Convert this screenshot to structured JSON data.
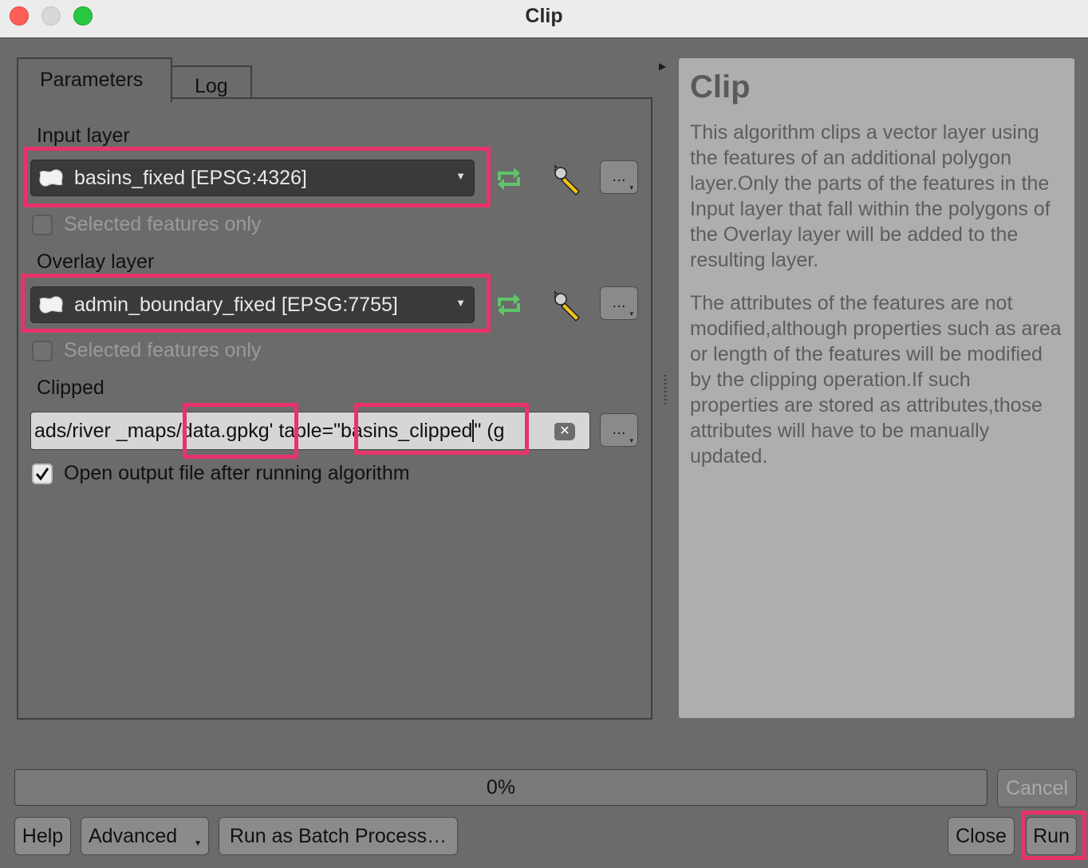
{
  "window": {
    "title": "Clip"
  },
  "tabs": {
    "parameters": "Parameters",
    "log": "Log"
  },
  "input_layer": {
    "label": "Input layer",
    "value": "basins_fixed [EPSG:4326]",
    "selected_only_label": "Selected features only",
    "selected_only_checked": false
  },
  "overlay_layer": {
    "label": "Overlay layer",
    "value": "admin_boundary_fixed [EPSG:7755]",
    "selected_only_label": "Selected features only",
    "selected_only_checked": false
  },
  "clipped": {
    "label": "Clipped",
    "path_part1": "ads/river _maps/",
    "path_part2": "data.gpkg'",
    "path_part3": " table=",
    "path_part4": "\"basins_clipped",
    "path_part5": "\" (g",
    "open_output_label": "Open output file after running algorithm",
    "open_output_checked": true
  },
  "common": {
    "more_button": "…"
  },
  "help": {
    "title": "Clip",
    "paragraph1": "This algorithm clips a vector layer using the features of an additional polygon layer.Only the parts of the features in the Input layer that fall within the polygons of the Overlay layer will be added to the resulting layer.",
    "paragraph2": "The attributes of the features are not modified,although properties such as area or length of the features will be modified by the clipping operation.If such properties are stored as attributes,those attributes will have to be manually updated."
  },
  "progress": {
    "text": "0%",
    "value": 0
  },
  "buttons": {
    "cancel": "Cancel",
    "help": "Help",
    "advanced": "Advanced",
    "batch": "Run as Batch Process…",
    "close": "Close",
    "run": "Run"
  },
  "colors": {
    "highlight": "#e8336a",
    "refresh_icon": "#5fc56b"
  }
}
